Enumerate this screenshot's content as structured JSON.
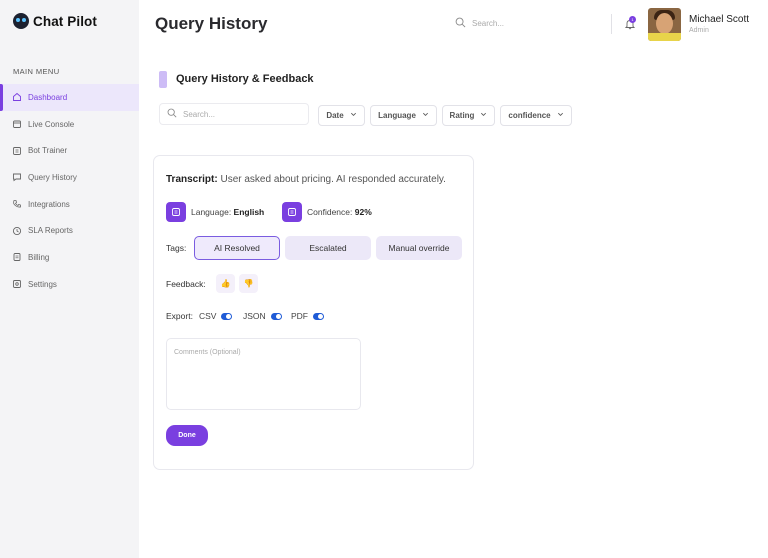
{
  "app": {
    "name": "Chat Pilot"
  },
  "sidebar": {
    "menu_title": "MAIN MENU",
    "items": [
      {
        "label": "Dashboard",
        "icon": "home-icon",
        "active": true
      },
      {
        "label": "Live Console",
        "icon": "calendar-icon"
      },
      {
        "label": "Bot Trainer",
        "icon": "grid-icon"
      },
      {
        "label": "Query History",
        "icon": "chat-icon"
      },
      {
        "label": "Integrations",
        "icon": "phone-icon"
      },
      {
        "label": "SLA Reports",
        "icon": "clock-icon"
      },
      {
        "label": "Billing",
        "icon": "document-icon"
      },
      {
        "label": "Settings",
        "icon": "settings-icon"
      }
    ]
  },
  "header": {
    "title": "Query History",
    "search_placeholder": "Search...",
    "notification_count": "1",
    "user": {
      "name": "Michael Scott",
      "role": "Admin"
    }
  },
  "main": {
    "section_title": "Query History & Feedback",
    "filters": {
      "search_placeholder": "Search...",
      "dropdowns": [
        "Date",
        "Language",
        "Rating",
        "confidence"
      ]
    },
    "card": {
      "transcript_label": "Transcript:",
      "transcript_text": " User asked about pricing. AI responded accurately.",
      "language_label": "Language: ",
      "language_value": "English",
      "confidence_label": "Confidence: ",
      "confidence_value": "92%",
      "tags_label": "Tags:",
      "tags": [
        "AI Resolved",
        "Escalated",
        "Manual override"
      ],
      "selected_tag": "AI Resolved",
      "feedback_label": "Feedback:",
      "export_label": "Export:",
      "export_options": [
        "CSV",
        "JSON",
        "PDF"
      ],
      "comments_placeholder": "Comments (Optional)",
      "done_label": "Done"
    }
  },
  "colors": {
    "accent": "#7a3fe0",
    "toggle": "#1f5bd6",
    "tag_bg": "#ece8f8"
  }
}
